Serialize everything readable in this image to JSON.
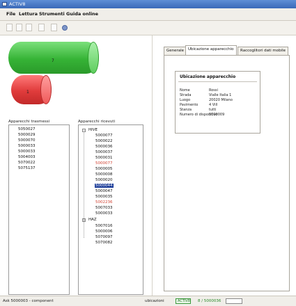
{
  "window": {
    "title": "ACTIV8"
  },
  "menu": {
    "items": [
      "File",
      "Lettura",
      "Strumenti",
      "Guida online"
    ]
  },
  "toolbar": {
    "buttons": [
      "new",
      "open",
      "save",
      "cut",
      "arrow",
      "info"
    ]
  },
  "cylinders": {
    "green_label": "7",
    "red_label": "1",
    "green_color": "#36b336",
    "red_color": "#e03b3b"
  },
  "lists": {
    "left_label": "Apparecchi trasmessi",
    "left_items": [
      "5050027",
      "5000029",
      "5000070",
      "5000033",
      "5000033",
      "5004003",
      "5070022",
      "5075137"
    ],
    "right_label": "Apparecchi ricevuti",
    "group1": "HIVE",
    "group1_items": [
      {
        "text": "5000077",
        "state": "normal"
      },
      {
        "text": "5000022",
        "state": "normal"
      },
      {
        "text": "5000036",
        "state": "normal"
      },
      {
        "text": "5000037",
        "state": "normal"
      },
      {
        "text": "5000031",
        "state": "normal"
      },
      {
        "text": "5000077",
        "state": "red"
      },
      {
        "text": "5000005",
        "state": "normal"
      },
      {
        "text": "5000008",
        "state": "normal"
      },
      {
        "text": "5000020",
        "state": "normal"
      },
      {
        "text": "5000044",
        "state": "selected"
      },
      {
        "text": "5000047",
        "state": "normal"
      },
      {
        "text": "5000035",
        "state": "normal"
      },
      {
        "text": "5002236",
        "state": "red"
      },
      {
        "text": "5007033",
        "state": "normal"
      },
      {
        "text": "5000033",
        "state": "normal"
      }
    ],
    "group2": "HAZ",
    "group2_items": [
      "5007016",
      "5000006",
      "5070097",
      "5070082"
    ]
  },
  "tabs": [
    "Generale",
    "Ubicazione apparecchio",
    "Raccoglitori dati mobile"
  ],
  "info": {
    "title": "Ubicazione apparecchio",
    "rows": [
      {
        "key": "Nome",
        "value": "Rossi"
      },
      {
        "key": "Strada",
        "value": "Vialle Italia 1"
      },
      {
        "key": "Luogo",
        "value": "20020 Milano"
      },
      {
        "key": "Pavimento",
        "value": "4 Vill"
      },
      {
        "key": "Stanza",
        "value": "tutti"
      },
      {
        "key": "Numero di dispositivo",
        "value": "5000009"
      }
    ]
  },
  "status": {
    "left": "Ask 5000003 - component",
    "label": "ubicazioni",
    "green_box": "ACTIV8",
    "green_text": "8 / 5000036",
    "white_box": ""
  }
}
